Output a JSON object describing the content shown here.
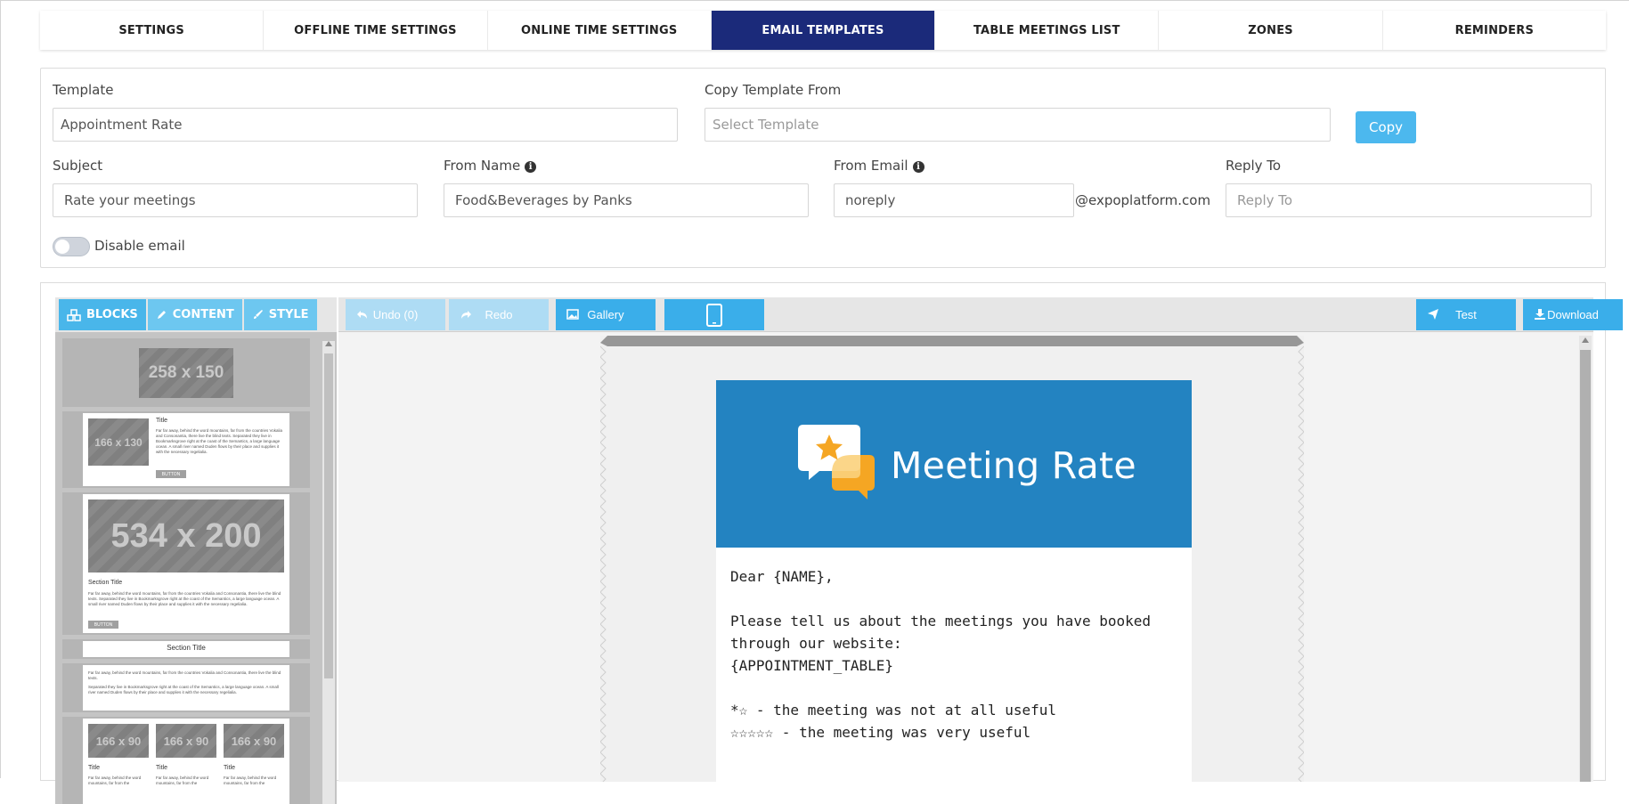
{
  "tabs": [
    {
      "label": "SETTINGS",
      "active": false
    },
    {
      "label": "OFFLINE TIME SETTINGS",
      "active": false
    },
    {
      "label": "ONLINE TIME SETTINGS",
      "active": false
    },
    {
      "label": "EMAIL TEMPLATES",
      "active": true
    },
    {
      "label": "TABLE MEETINGS LIST",
      "active": false
    },
    {
      "label": "ZONES",
      "active": false
    },
    {
      "label": "REMINDERS",
      "active": false
    }
  ],
  "form": {
    "template_label": "Template",
    "template_value": "Appointment Rate",
    "copy_from_label": "Copy Template From",
    "copy_from_placeholder": "Select Template",
    "copy_button": "Copy",
    "subject_label": "Subject",
    "subject_value": "Rate your meetings",
    "from_name_label": "From Name",
    "from_name_value": "Food&Beverages by Panks",
    "from_email_label": "From Email",
    "from_email_value": "noreply",
    "from_email_suffix": "@expoplatform.com",
    "reply_to_label": "Reply To",
    "reply_to_placeholder": "Reply To",
    "disable_email_label": "Disable email",
    "disable_email_on": false
  },
  "editor": {
    "left_tabs": [
      "BLOCKS",
      "CONTENT",
      "STYLE"
    ],
    "toolbar": {
      "undo": "Undo (0)",
      "redo": "Redo",
      "gallery": "Gallery",
      "test": "Test",
      "download": "Download"
    },
    "blocks": {
      "b1_img": "258 x 150",
      "b2_img": "166 x 130",
      "b2_title": "Title",
      "b2_text": "Far far away, behind the word mountains, far from the countries Vokalia and Consonantia, there live the blind texts. Separated they live in Bookmarksgrove right at the coast of the Semantics, a large language ocean. A small river named Duden flows by their place and supplies it with the necessary regelialia.",
      "b2_btn": "BUTTON",
      "b3_img": "534 x 200",
      "b3_title": "Section Title",
      "b3_text": "Far far away, behind the word mountains, far from the countries Vokalia and Consonantia, there live the blind texts. Separated they live in Bookmarksgrove right at the coast of the Semantics, a large language ocean. A small river named Duden flows by their place and supplies it with the necessary regelialia.",
      "b3_btn": "BUTTON",
      "b4_title": "Section Title",
      "b5_text1": "Far far away, behind the word mountains, far from the countries Vokalia and Consonantia, there live the blind texts.",
      "b5_text2": "Separated they live in Bookmarksgrove right at the coast of the Semantics, a large language ocean. A small river named Duden flows by their place and supplies it with the necessary regelialia.",
      "b6_img": "166 x 90",
      "b6_title": "Title",
      "b6_text": "Far far away, behind the word mountains, far from the"
    },
    "email": {
      "header_title": "Meeting Rate",
      "greeting": "Dear {NAME},",
      "line1": "Please tell us about the meetings you have booked through our website:",
      "line2": "{APPOINTMENT_TABLE}",
      "rating_low": "*☆ - the meeting was not at all useful",
      "rating_high": "☆☆☆☆☆ - the meeting was very useful"
    }
  },
  "colors": {
    "active_tab": "#1b2a7a",
    "accent": "#4cb8ee",
    "email_header": "#2383c1"
  }
}
